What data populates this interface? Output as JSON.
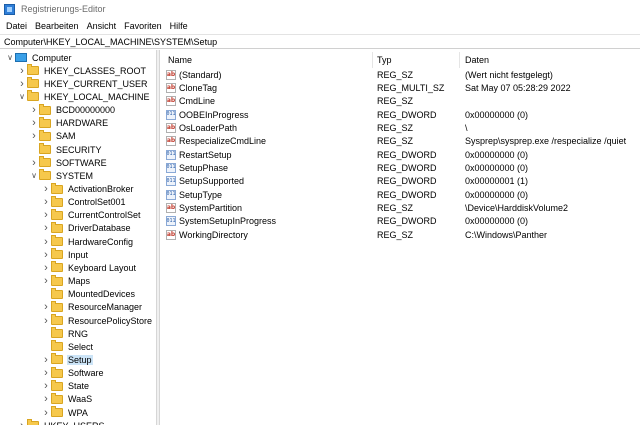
{
  "window": {
    "title": "Registrierungs-Editor"
  },
  "menu": [
    "Datei",
    "Bearbeiten",
    "Ansicht",
    "Favoriten",
    "Hilfe"
  ],
  "address": "Computer\\HKEY_LOCAL_MACHINE\\SYSTEM\\Setup",
  "tree": [
    {
      "label": "Computer",
      "expanded": true,
      "icon": "monitor-icon"
    },
    {
      "label": "HKEY_CLASSES_ROOT"
    },
    {
      "label": "HKEY_CURRENT_USER"
    },
    {
      "label": "HKEY_LOCAL_MACHINE",
      "expanded": true
    },
    {
      "label": "BCD00000000"
    },
    {
      "label": "HARDWARE"
    },
    {
      "label": "SAM"
    },
    {
      "label": "SECURITY",
      "no_chevron": true
    },
    {
      "label": "SOFTWARE"
    },
    {
      "label": "SYSTEM",
      "expanded": true
    },
    {
      "label": "ActivationBroker"
    },
    {
      "label": "ControlSet001"
    },
    {
      "label": "CurrentControlSet"
    },
    {
      "label": "DriverDatabase"
    },
    {
      "label": "HardwareConfig"
    },
    {
      "label": "Input"
    },
    {
      "label": "Keyboard Layout"
    },
    {
      "label": "Maps"
    },
    {
      "label": "MountedDevices",
      "no_chevron": true
    },
    {
      "label": "ResourceManager"
    },
    {
      "label": "ResourcePolicyStore"
    },
    {
      "label": "RNG",
      "no_chevron": true
    },
    {
      "label": "Select",
      "no_chevron": true
    },
    {
      "label": "Setup",
      "selected": true
    },
    {
      "label": "Software"
    },
    {
      "label": "State"
    },
    {
      "label": "WaaS"
    },
    {
      "label": "WPA"
    },
    {
      "label": "HKEY_USERS"
    }
  ],
  "columns": {
    "name": "Name",
    "type": "Typ",
    "data": "Daten"
  },
  "values": [
    {
      "name": "(Standard)",
      "type": "REG_SZ",
      "data": "(Wert nicht festgelegt)",
      "icon": "ab"
    },
    {
      "name": "CloneTag",
      "type": "REG_MULTI_SZ",
      "data": "Sat May 07 05:28:29 2022",
      "icon": "ab"
    },
    {
      "name": "CmdLine",
      "type": "REG_SZ",
      "data": "",
      "icon": "ab"
    },
    {
      "name": "OOBEInProgress",
      "type": "REG_DWORD",
      "data": "0x00000000 (0)",
      "icon": "bin"
    },
    {
      "name": "OsLoaderPath",
      "type": "REG_SZ",
      "data": "\\",
      "icon": "ab"
    },
    {
      "name": "RespecializeCmdLine",
      "type": "REG_SZ",
      "data": "Sysprep\\sysprep.exe /respecialize /quiet",
      "icon": "ab"
    },
    {
      "name": "RestartSetup",
      "type": "REG_DWORD",
      "data": "0x00000000 (0)",
      "icon": "bin"
    },
    {
      "name": "SetupPhase",
      "type": "REG_DWORD",
      "data": "0x00000000 (0)",
      "icon": "bin"
    },
    {
      "name": "SetupSupported",
      "type": "REG_DWORD",
      "data": "0x00000001 (1)",
      "icon": "bin"
    },
    {
      "name": "SetupType",
      "type": "REG_DWORD",
      "data": "0x00000000 (0)",
      "icon": "bin"
    },
    {
      "name": "SystemPartition",
      "type": "REG_SZ",
      "data": "\\Device\\HarddiskVolume2",
      "icon": "ab"
    },
    {
      "name": "SystemSetupInProgress",
      "type": "REG_DWORD",
      "data": "0x00000000 (0)",
      "icon": "bin"
    },
    {
      "name": "WorkingDirectory",
      "type": "REG_SZ",
      "data": "C:\\Windows\\Panther",
      "icon": "ab"
    }
  ]
}
